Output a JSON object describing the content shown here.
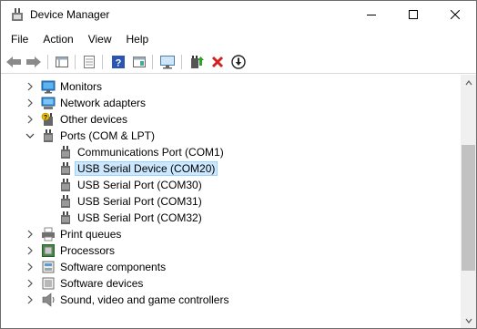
{
  "window": {
    "title": "Device Manager"
  },
  "menu": {
    "items": [
      "File",
      "Action",
      "View",
      "Help"
    ]
  },
  "toolbar": {
    "buttons": [
      "back-icon",
      "forward-icon",
      "show-hide-console-tree-icon",
      "properties-icon",
      "help-icon",
      "action-pane-icon",
      "scan-hardware-icon",
      "update-driver-icon",
      "uninstall-icon",
      "disable-device-icon"
    ]
  },
  "tree": {
    "rows": [
      {
        "label": "Monitors",
        "icon": "monitor-icon",
        "expander": "collapsed"
      },
      {
        "label": "Network adapters",
        "icon": "network-adapter-icon",
        "expander": "collapsed"
      },
      {
        "label": "Other devices",
        "icon": "unknown-device-icon",
        "expander": "collapsed"
      },
      {
        "label": "Ports (COM & LPT)",
        "icon": "port-icon",
        "expander": "expanded"
      },
      {
        "label": "Communications Port (COM1)",
        "icon": "port-icon",
        "expander": "none"
      },
      {
        "label": "USB Serial Device (COM20)",
        "icon": "port-icon",
        "expander": "none",
        "selected": true
      },
      {
        "label": "USB Serial Port (COM30)",
        "icon": "port-icon",
        "expander": "none"
      },
      {
        "label": "USB Serial Port (COM31)",
        "icon": "port-icon",
        "expander": "none"
      },
      {
        "label": "USB Serial Port (COM32)",
        "icon": "port-icon",
        "expander": "none"
      },
      {
        "label": "Print queues",
        "icon": "printer-icon",
        "expander": "collapsed"
      },
      {
        "label": "Processors",
        "icon": "processor-icon",
        "expander": "collapsed"
      },
      {
        "label": "Software components",
        "icon": "software-component-icon",
        "expander": "collapsed"
      },
      {
        "label": "Software devices",
        "icon": "software-device-icon",
        "expander": "collapsed"
      },
      {
        "label": "Sound, video and game controllers",
        "icon": "speaker-icon",
        "expander": "collapsed"
      }
    ]
  },
  "colors": {
    "selection_bg": "#cce8ff",
    "selection_border": "#99d1ff",
    "uninstall_red": "#d32020",
    "help_blue": "#2a55b5"
  }
}
